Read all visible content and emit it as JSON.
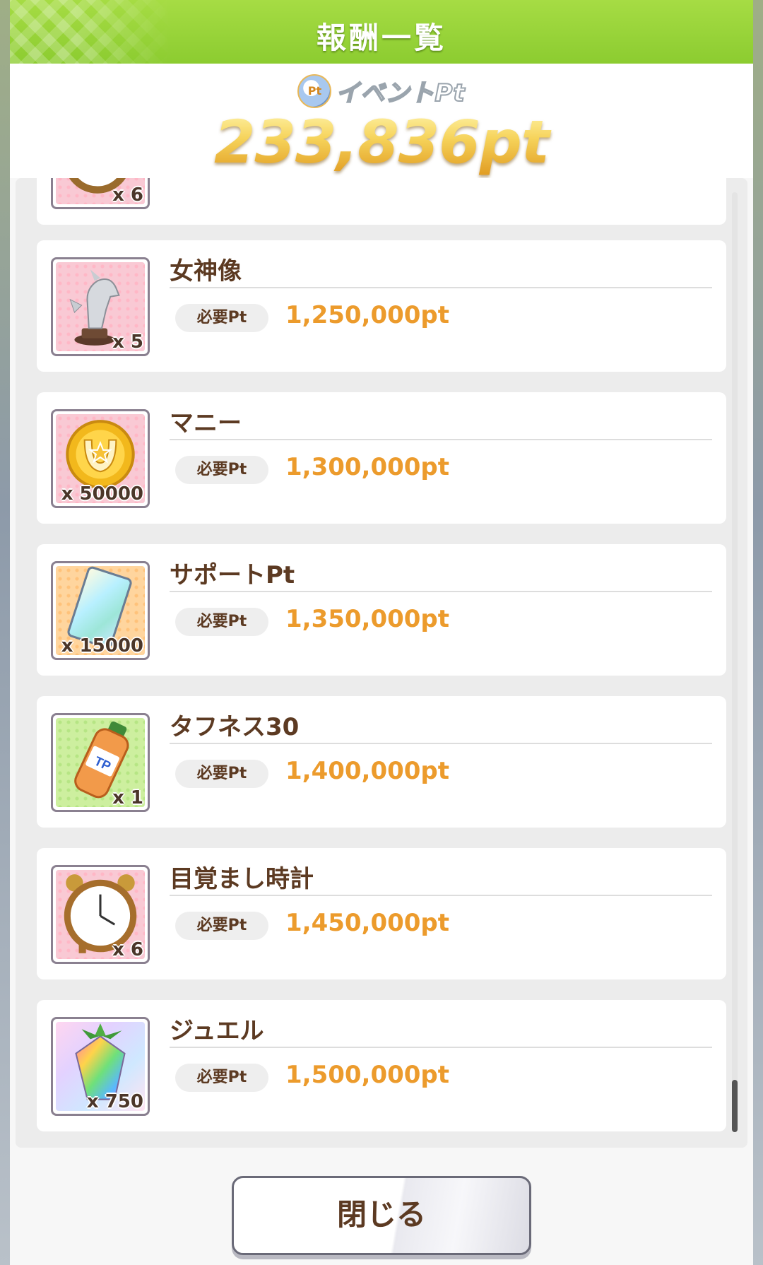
{
  "header": {
    "title": "報酬一覧"
  },
  "event_points": {
    "label": "イベントPt",
    "coin_text": "Pt",
    "value": "233,836pt"
  },
  "required_label": "必要Pt",
  "partial_item": {
    "qty": "x 6"
  },
  "rewards": [
    {
      "name": "女神像",
      "qty": "x 5",
      "required": "1,250,000pt"
    },
    {
      "name": "マニー",
      "qty": "x 50000",
      "required": "1,300,000pt"
    },
    {
      "name": "サポートPt",
      "qty": "x 15000",
      "required": "1,350,000pt"
    },
    {
      "name": "タフネス30",
      "qty": "x 1",
      "required": "1,400,000pt",
      "bottle_text": "TP"
    },
    {
      "name": "目覚まし時計",
      "qty": "x 6",
      "required": "1,450,000pt"
    },
    {
      "name": "ジュエル",
      "qty": "x 750",
      "required": "1,500,000pt"
    }
  ],
  "footer": {
    "close_label": "閉じる"
  }
}
